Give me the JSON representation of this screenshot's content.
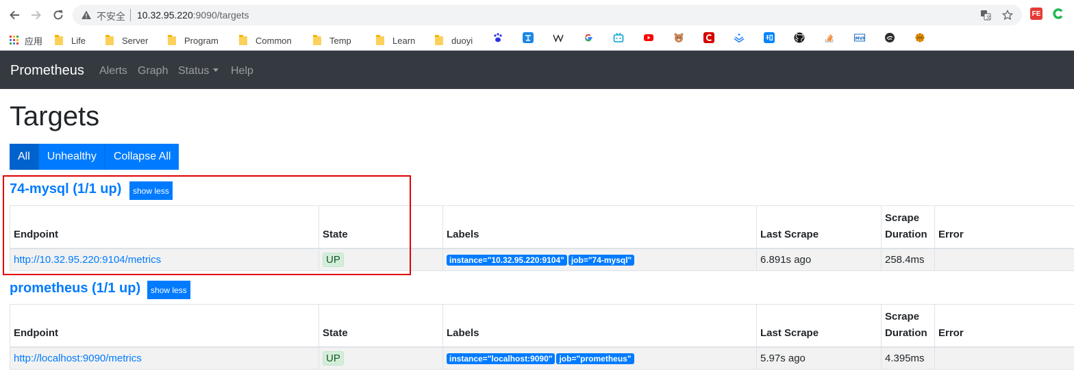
{
  "browser": {
    "insecure_label": "不安全",
    "url_host": "10.32.95.220",
    "url_path": ":9090/targets"
  },
  "bookmarks": [
    {
      "label": "应用"
    },
    {
      "label": "Life"
    },
    {
      "label": "Server"
    },
    {
      "label": "Program"
    },
    {
      "label": "Common"
    },
    {
      "label": "Temp"
    },
    {
      "label": "Learn"
    },
    {
      "label": "duoyi"
    }
  ],
  "navbar": {
    "brand": "Prometheus",
    "links": [
      "Alerts",
      "Graph",
      "Status",
      "Help"
    ]
  },
  "page": {
    "title": "Targets",
    "filters": [
      "All",
      "Unhealthy",
      "Collapse All"
    ],
    "active_filter": "All"
  },
  "columns": {
    "endpoint": "Endpoint",
    "state": "State",
    "labels": "Labels",
    "last_scrape": "Last Scrape",
    "scrape_duration_1": "Scrape",
    "scrape_duration_2": "Duration",
    "error": "Error"
  },
  "jobs": [
    {
      "title": "74-mysql (1/1 up)",
      "toggle": "show less",
      "endpoint": "http://10.32.95.220:9104/metrics",
      "state": "UP",
      "labels": [
        "instance=\"10.32.95.220:9104\"",
        "job=\"74-mysql\""
      ],
      "last_scrape": "6.891s ago",
      "scrape_duration": "258.4ms",
      "error": ""
    },
    {
      "title": "prometheus (1/1 up)",
      "toggle": "show less",
      "endpoint": "http://localhost:9090/metrics",
      "state": "UP",
      "labels": [
        "instance=\"localhost:9090\"",
        "job=\"prometheus\""
      ],
      "last_scrape": "5.97s ago",
      "scrape_duration": "4.395ms",
      "error": ""
    }
  ],
  "colors": {
    "primary": "#007bff",
    "navbar": "#343a40",
    "state_up_bg": "#d4edda",
    "highlight": "#e00000"
  }
}
